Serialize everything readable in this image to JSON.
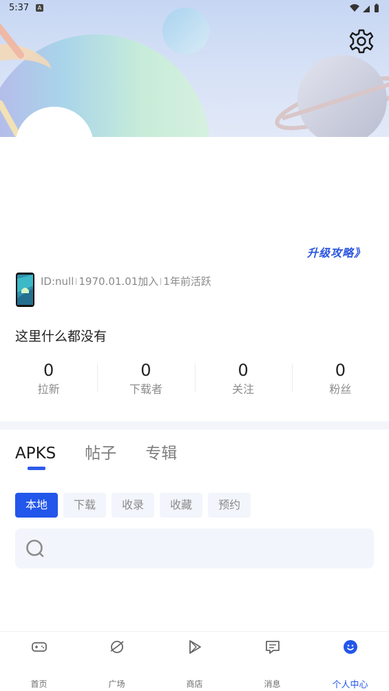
{
  "status_bar": {
    "time": "5:37",
    "notification_glyph": "A"
  },
  "header": {
    "settings_icon": "gear-icon"
  },
  "profile": {
    "upgrade_link": "升级攻略》",
    "id_text": "ID:null",
    "join_date": "1970.01.01加入",
    "last_active": "1年前活跃",
    "bio": "这里什么都没有"
  },
  "stats": [
    {
      "value": "0",
      "label": "拉新"
    },
    {
      "value": "0",
      "label": "下载者"
    },
    {
      "value": "0",
      "label": "关注"
    },
    {
      "value": "0",
      "label": "粉丝"
    }
  ],
  "content_tabs": [
    {
      "label": "APKS",
      "active": true
    },
    {
      "label": "帖子",
      "active": false
    },
    {
      "label": "专辑",
      "active": false
    }
  ],
  "filter_chips": [
    {
      "label": "本地",
      "active": true
    },
    {
      "label": "下载",
      "active": false
    },
    {
      "label": "收录",
      "active": false
    },
    {
      "label": "收藏",
      "active": false
    },
    {
      "label": "预约",
      "active": false
    }
  ],
  "search": {
    "icon": "search-icon"
  },
  "bottom_nav": [
    {
      "label": "首页",
      "icon": "gamepad-icon"
    },
    {
      "label": "广场",
      "icon": "planet-icon"
    },
    {
      "label": "商店",
      "icon": "play-icon"
    },
    {
      "label": "消息",
      "icon": "message-icon"
    },
    {
      "label": "个人中心",
      "icon": "smiley-icon",
      "active": true
    }
  ],
  "colors": {
    "accent": "#2356ea",
    "muted_text": "#8a8a8a",
    "chip_bg": "#f2f5fb"
  }
}
